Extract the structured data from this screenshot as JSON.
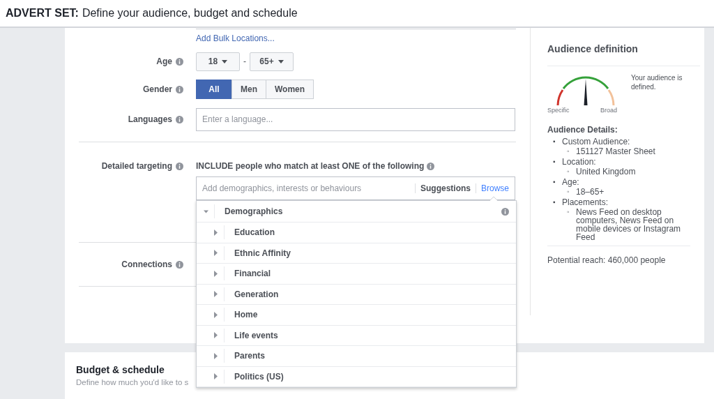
{
  "header": {
    "label": "ADVERT SET:",
    "title": "Define your audience, budget and schedule"
  },
  "audience": {
    "bulk_link": "Add Bulk Locations...",
    "age": {
      "label": "Age",
      "min": "18",
      "separator": "-",
      "max": "65+"
    },
    "gender": {
      "label": "Gender",
      "options": [
        {
          "label": "All",
          "selected": true
        },
        {
          "label": "Men",
          "selected": false
        },
        {
          "label": "Women",
          "selected": false
        }
      ]
    },
    "languages": {
      "label": "Languages",
      "placeholder": "Enter a language..."
    },
    "targeting": {
      "label": "Detailed targeting",
      "include_text": "INCLUDE people who match at least ONE of the following",
      "placeholder": "Add demographics, interests or behaviours",
      "tabs": [
        {
          "label": "Suggestions",
          "selected": false
        },
        {
          "label": "Browse",
          "selected": true
        }
      ],
      "browse": {
        "label": "Demographics",
        "expanded": true,
        "children": [
          {
            "label": "Education"
          },
          {
            "label": "Ethnic Affinity"
          },
          {
            "label": "Financial"
          },
          {
            "label": "Generation"
          },
          {
            "label": "Home"
          },
          {
            "label": "Life events"
          },
          {
            "label": "Parents"
          },
          {
            "label": "Politics (US)"
          }
        ]
      }
    },
    "connections": {
      "label": "Connections"
    }
  },
  "definition": {
    "title": "Audience definition",
    "gauge_left": "Specific",
    "gauge_right": "Broad",
    "status": "Your audience is defined.",
    "details_title": "Audience Details:",
    "details": [
      {
        "marker": "▪",
        "label": "Custom Audience:",
        "children": [
          {
            "marker": "◦",
            "label": "151127 Master Sheet"
          }
        ]
      },
      {
        "marker": "▪",
        "label": "Location:",
        "children": [
          {
            "marker": "◦",
            "label": "United Kingdom"
          }
        ]
      },
      {
        "marker": "▪",
        "label": "Age:",
        "children": [
          {
            "marker": "◦",
            "label": "18–65+"
          }
        ]
      },
      {
        "marker": "▪",
        "label": "Placements:",
        "children": [
          {
            "marker": "◦",
            "label": "News Feed on desktop computers, News Feed on mobile devices or Instagram Feed"
          }
        ]
      }
    ],
    "reach": "Potential reach: 460,000 people"
  },
  "budget": {
    "title": "Budget & schedule",
    "subtitle": "Define how much you'd like to s"
  }
}
